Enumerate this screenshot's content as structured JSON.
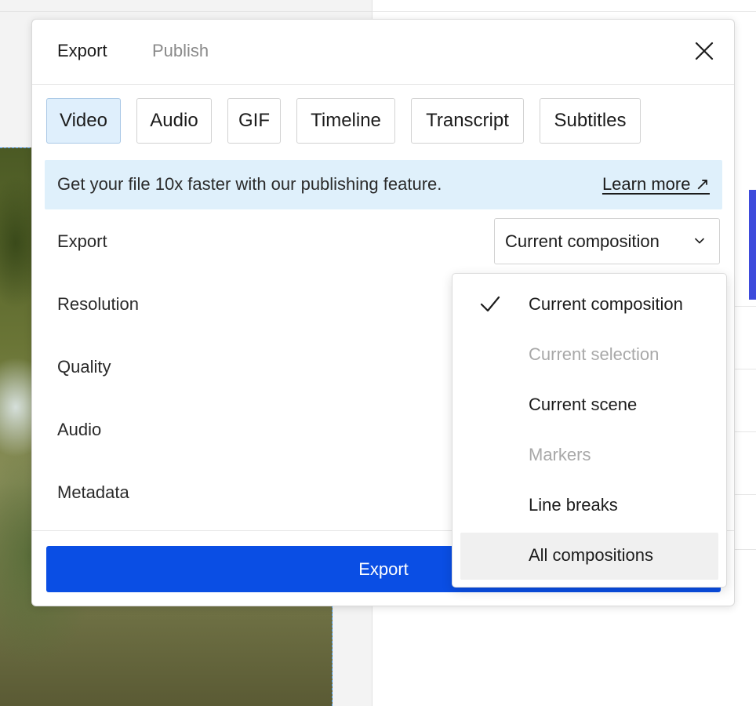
{
  "modal": {
    "tabs": [
      "Export",
      "Publish"
    ],
    "active_tab": "Export",
    "close_icon": "close-icon"
  },
  "formats": [
    "Video",
    "Audio",
    "GIF",
    "Timeline",
    "Transcript",
    "Subtitles"
  ],
  "active_format": "Video",
  "banner": {
    "text": "Get your file 10x faster with our publishing feature.",
    "link": "Learn more ↗"
  },
  "fields": {
    "export": "Export",
    "resolution": "Resolution",
    "quality": "Quality",
    "audio": "Audio",
    "metadata": "Metadata"
  },
  "export_select": {
    "value": "Current composition"
  },
  "export_button": "Export",
  "dropdown": {
    "items": [
      {
        "label": "Current composition",
        "checked": true,
        "disabled": false
      },
      {
        "label": "Current selection",
        "checked": false,
        "disabled": true
      },
      {
        "label": "Current scene",
        "checked": false,
        "disabled": false
      },
      {
        "label": "Markers",
        "checked": false,
        "disabled": true
      },
      {
        "label": "Line breaks",
        "checked": false,
        "disabled": false
      },
      {
        "label": "All compositions",
        "checked": false,
        "disabled": false,
        "hovered": true
      }
    ]
  },
  "colors": {
    "primary": "#0a4ee4",
    "banner_bg": "#dff0fb",
    "active_format_bg": "#dfeffc",
    "selection_outline": "#3b8fe0",
    "sidebar_accent": "#3d4bdc"
  }
}
